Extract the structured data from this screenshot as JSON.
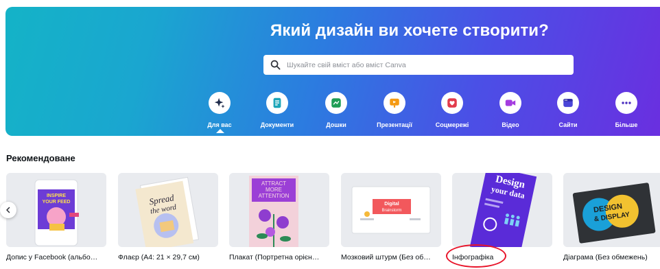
{
  "hero": {
    "title": "Який дизайн ви хочете створити?",
    "search_placeholder": "Шукайте свій вміст або вміст Canva"
  },
  "categories": [
    {
      "label": "Для вас",
      "icon": "sparkle-icon",
      "color": "#1e2a4a",
      "active": true
    },
    {
      "label": "Документи",
      "icon": "document-icon",
      "color": "#1ba5b8"
    },
    {
      "label": "Дошки",
      "icon": "whiteboard-icon",
      "color": "#1f9d55"
    },
    {
      "label": "Презентації",
      "icon": "presentation-icon",
      "color": "#f59a13"
    },
    {
      "label": "Соцмережі",
      "icon": "heart-icon",
      "color": "#e23b4b"
    },
    {
      "label": "Відео",
      "icon": "video-icon",
      "color": "#a43ce0"
    },
    {
      "label": "Сайти",
      "icon": "website-icon",
      "color": "#4a45d8"
    },
    {
      "label": "Більше",
      "icon": "more-icon",
      "color": "#4b2fbf"
    }
  ],
  "recommended": {
    "title": "Рекомендоване",
    "items": [
      {
        "caption": "Допис у Facebook (альбо…",
        "thumb_text": [
          "INSPIRE",
          "YOUR FEED"
        ]
      },
      {
        "caption": "Флаєр (A4: 21 × 29,7 см)",
        "thumb_text": [
          "Spread",
          "the word"
        ]
      },
      {
        "caption": "Плакат (Портретна орієн…",
        "thumb_text": [
          "ATTRACT",
          "MORE",
          "ATTENTION"
        ]
      },
      {
        "caption": "Мозковий штурм (Без об…",
        "thumb_text": [
          "Digital",
          "Brainstorm"
        ]
      },
      {
        "caption": "Інфографіка",
        "thumb_text": [
          "Design",
          "your data"
        ]
      },
      {
        "caption": "Діаграма (Без обмежень)",
        "thumb_text": [
          "DESIGN",
          "& DISPLAY"
        ]
      }
    ]
  },
  "colors": {
    "highlight": "#e8142a",
    "text": "#0d1216"
  }
}
